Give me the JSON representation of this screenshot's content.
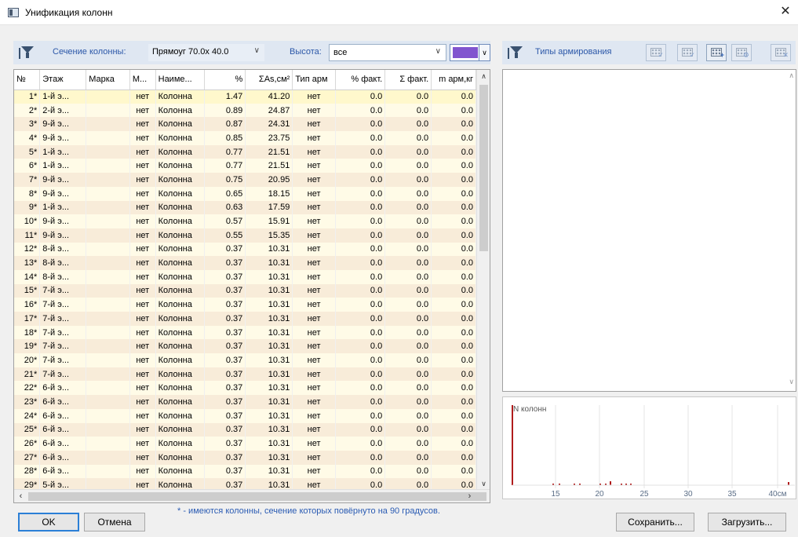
{
  "window": {
    "title": "Унификация колонн",
    "close_glyph": "✕"
  },
  "toolbar": {
    "section_label": "Сечение колонны:",
    "section_value": "Прямоуг  70.0x 40.0",
    "height_label": "Высота:",
    "height_value": "все",
    "selected_color": "#8155cf",
    "types_label": "Типы армирования"
  },
  "table": {
    "columns": [
      "№",
      "Этаж",
      "Марка",
      "М...",
      "Наиме...",
      "%",
      "ΣAs,см²",
      "Тип арм",
      "% факт.",
      "Σ факт.",
      "m арм,кг"
    ],
    "rows": [
      [
        "1*",
        "1-й э...",
        "",
        "нет",
        "Колонна",
        "1.47",
        "41.20",
        "нет",
        "0.0",
        "0.0",
        "0.0"
      ],
      [
        "2*",
        "2-й э...",
        "",
        "нет",
        "Колонна",
        "0.89",
        "24.87",
        "нет",
        "0.0",
        "0.0",
        "0.0"
      ],
      [
        "3*",
        "9-й э...",
        "",
        "нет",
        "Колонна",
        "0.87",
        "24.31",
        "нет",
        "0.0",
        "0.0",
        "0.0"
      ],
      [
        "4*",
        "9-й э...",
        "",
        "нет",
        "Колонна",
        "0.85",
        "23.75",
        "нет",
        "0.0",
        "0.0",
        "0.0"
      ],
      [
        "5*",
        "1-й э...",
        "",
        "нет",
        "Колонна",
        "0.77",
        "21.51",
        "нет",
        "0.0",
        "0.0",
        "0.0"
      ],
      [
        "6*",
        "1-й э...",
        "",
        "нет",
        "Колонна",
        "0.77",
        "21.51",
        "нет",
        "0.0",
        "0.0",
        "0.0"
      ],
      [
        "7*",
        "9-й э...",
        "",
        "нет",
        "Колонна",
        "0.75",
        "20.95",
        "нет",
        "0.0",
        "0.0",
        "0.0"
      ],
      [
        "8*",
        "9-й э...",
        "",
        "нет",
        "Колонна",
        "0.65",
        "18.15",
        "нет",
        "0.0",
        "0.0",
        "0.0"
      ],
      [
        "9*",
        "1-й э...",
        "",
        "нет",
        "Колонна",
        "0.63",
        "17.59",
        "нет",
        "0.0",
        "0.0",
        "0.0"
      ],
      [
        "10*",
        "9-й э...",
        "",
        "нет",
        "Колонна",
        "0.57",
        "15.91",
        "нет",
        "0.0",
        "0.0",
        "0.0"
      ],
      [
        "11*",
        "9-й э...",
        "",
        "нет",
        "Колонна",
        "0.55",
        "15.35",
        "нет",
        "0.0",
        "0.0",
        "0.0"
      ],
      [
        "12*",
        "8-й э...",
        "",
        "нет",
        "Колонна",
        "0.37",
        "10.31",
        "нет",
        "0.0",
        "0.0",
        "0.0"
      ],
      [
        "13*",
        "8-й э...",
        "",
        "нет",
        "Колонна",
        "0.37",
        "10.31",
        "нет",
        "0.0",
        "0.0",
        "0.0"
      ],
      [
        "14*",
        "8-й э...",
        "",
        "нет",
        "Колонна",
        "0.37",
        "10.31",
        "нет",
        "0.0",
        "0.0",
        "0.0"
      ],
      [
        "15*",
        "7-й э...",
        "",
        "нет",
        "Колонна",
        "0.37",
        "10.31",
        "нет",
        "0.0",
        "0.0",
        "0.0"
      ],
      [
        "16*",
        "7-й э...",
        "",
        "нет",
        "Колонна",
        "0.37",
        "10.31",
        "нет",
        "0.0",
        "0.0",
        "0.0"
      ],
      [
        "17*",
        "7-й э...",
        "",
        "нет",
        "Колонна",
        "0.37",
        "10.31",
        "нет",
        "0.0",
        "0.0",
        "0.0"
      ],
      [
        "18*",
        "7-й э...",
        "",
        "нет",
        "Колонна",
        "0.37",
        "10.31",
        "нет",
        "0.0",
        "0.0",
        "0.0"
      ],
      [
        "19*",
        "7-й э...",
        "",
        "нет",
        "Колонна",
        "0.37",
        "10.31",
        "нет",
        "0.0",
        "0.0",
        "0.0"
      ],
      [
        "20*",
        "7-й э...",
        "",
        "нет",
        "Колонна",
        "0.37",
        "10.31",
        "нет",
        "0.0",
        "0.0",
        "0.0"
      ],
      [
        "21*",
        "7-й э...",
        "",
        "нет",
        "Колонна",
        "0.37",
        "10.31",
        "нет",
        "0.0",
        "0.0",
        "0.0"
      ],
      [
        "22*",
        "6-й э...",
        "",
        "нет",
        "Колонна",
        "0.37",
        "10.31",
        "нет",
        "0.0",
        "0.0",
        "0.0"
      ],
      [
        "23*",
        "6-й э...",
        "",
        "нет",
        "Колонна",
        "0.37",
        "10.31",
        "нет",
        "0.0",
        "0.0",
        "0.0"
      ],
      [
        "24*",
        "6-й э...",
        "",
        "нет",
        "Колонна",
        "0.37",
        "10.31",
        "нет",
        "0.0",
        "0.0",
        "0.0"
      ],
      [
        "25*",
        "6-й э...",
        "",
        "нет",
        "Колонна",
        "0.37",
        "10.31",
        "нет",
        "0.0",
        "0.0",
        "0.0"
      ],
      [
        "26*",
        "6-й э...",
        "",
        "нет",
        "Колонна",
        "0.37",
        "10.31",
        "нет",
        "0.0",
        "0.0",
        "0.0"
      ],
      [
        "27*",
        "6-й э...",
        "",
        "нет",
        "Колонна",
        "0.37",
        "10.31",
        "нет",
        "0.0",
        "0.0",
        "0.0"
      ],
      [
        "28*",
        "6-й э...",
        "",
        "нет",
        "Колонна",
        "0.37",
        "10.31",
        "нет",
        "0.0",
        "0.0",
        "0.0"
      ],
      [
        "29*",
        "5-й э...",
        "",
        "нет",
        "Колонна",
        "0.37",
        "10.31",
        "нет",
        "0.0",
        "0.0",
        "0.0"
      ]
    ]
  },
  "histogram": {
    "ylabel": "N колонн",
    "xticks": [
      "15",
      "20",
      "25",
      "30",
      "35",
      "40см"
    ],
    "bar_color": "#b01c1c"
  },
  "footnote": "* - имеются колонны, сечение которых повёрнуто на 90 градусов.",
  "buttons": {
    "ok": "OK",
    "cancel": "Отмена",
    "save": "Сохранить...",
    "load": "Загрузить..."
  }
}
